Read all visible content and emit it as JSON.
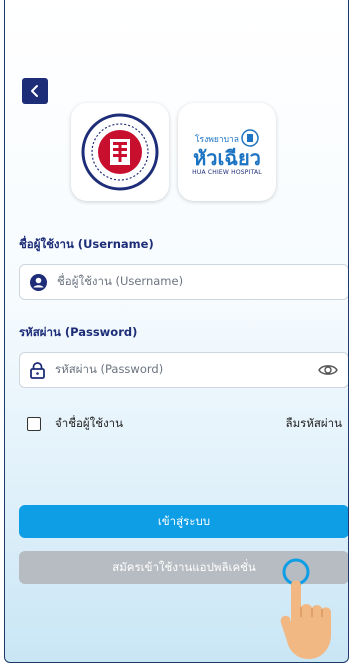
{
  "header": {
    "back_icon": "chevron-left-icon"
  },
  "logos": {
    "foundation": {
      "name": "foundation-seal"
    },
    "hospital": {
      "line1": "โรงพยาบาล",
      "line2": "หัวเฉียว",
      "line3": "HUA CHIEW HOSPITAL"
    }
  },
  "username": {
    "label": "ชื่อผู้ใช้งาน (Username)",
    "placeholder": "ชื่อผู้ใช้งาน (Username)",
    "icon": "user-icon"
  },
  "password": {
    "label": "รหัสผ่าน (Password)",
    "placeholder": "รหัสผ่าน (Password)",
    "icon": "lock-icon",
    "toggle_icon": "eye-icon"
  },
  "remember_label": "จำชื่อผู้ใช้งาน",
  "forgot_label": "ลืมรหัสผ่าน",
  "login_button": "เข้าสู่ระบบ",
  "register_button": "สมัครเข้าใช้งานแอปพลิเคชั่น",
  "colors": {
    "navy": "#1d2d78",
    "primary": "#0e9ee6",
    "disabled": "#b7bcc2",
    "hospital_blue": "#1d74c2"
  }
}
